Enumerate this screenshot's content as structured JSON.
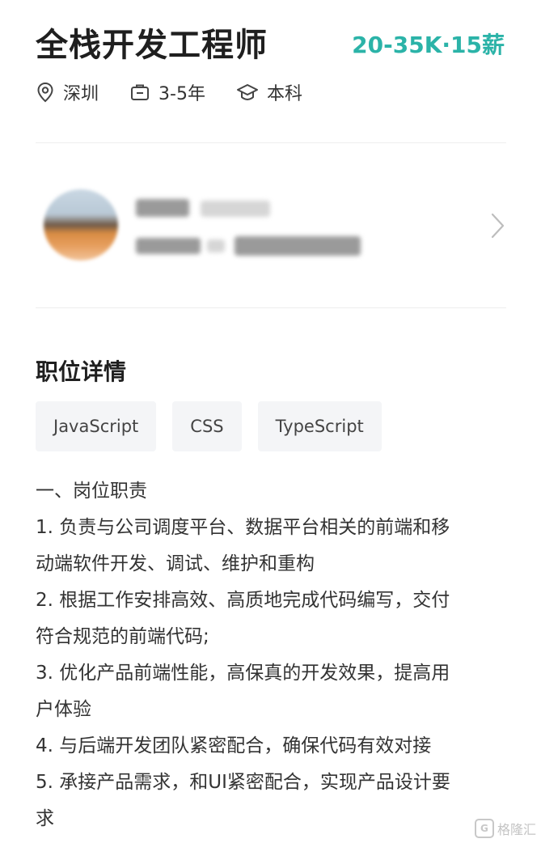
{
  "header": {
    "title": "全栈开发工程师",
    "salary": "20-35K·15薪"
  },
  "meta": {
    "location": {
      "icon": "location-pin-icon",
      "label": "深圳"
    },
    "experience": {
      "icon": "briefcase-icon",
      "label": "3-5年"
    },
    "education": {
      "icon": "graduation-cap-icon",
      "label": "本科"
    }
  },
  "recruiter": {
    "avatar": "avatar",
    "chevron": "chevron-right-icon"
  },
  "details": {
    "section_title": "职位详情",
    "tags": [
      "JavaScript",
      "CSS",
      "TypeScript"
    ],
    "lines": [
      "一、岗位职责",
      "1. 负责与公司调度平台、数据平台相关的前端和移",
      "动端软件开发、调试、维护和重构",
      "2. 根据工作安排高效、高质地完成代码编写，交付",
      "符合规范的前端代码;",
      "3. 优化产品前端性能，高保真的开发效果，提高用",
      "户体验",
      "4. 与后端开发团队紧密配合，确保代码有效对接",
      "5. 承接产品需求，和UI紧密配合，实现产品设计要",
      "求"
    ]
  },
  "watermark": {
    "logo": "G",
    "text": "格隆汇"
  },
  "colors": {
    "salary": "#2bb3a8",
    "tag_bg": "#f4f5f7",
    "divider": "#eeeeee"
  }
}
